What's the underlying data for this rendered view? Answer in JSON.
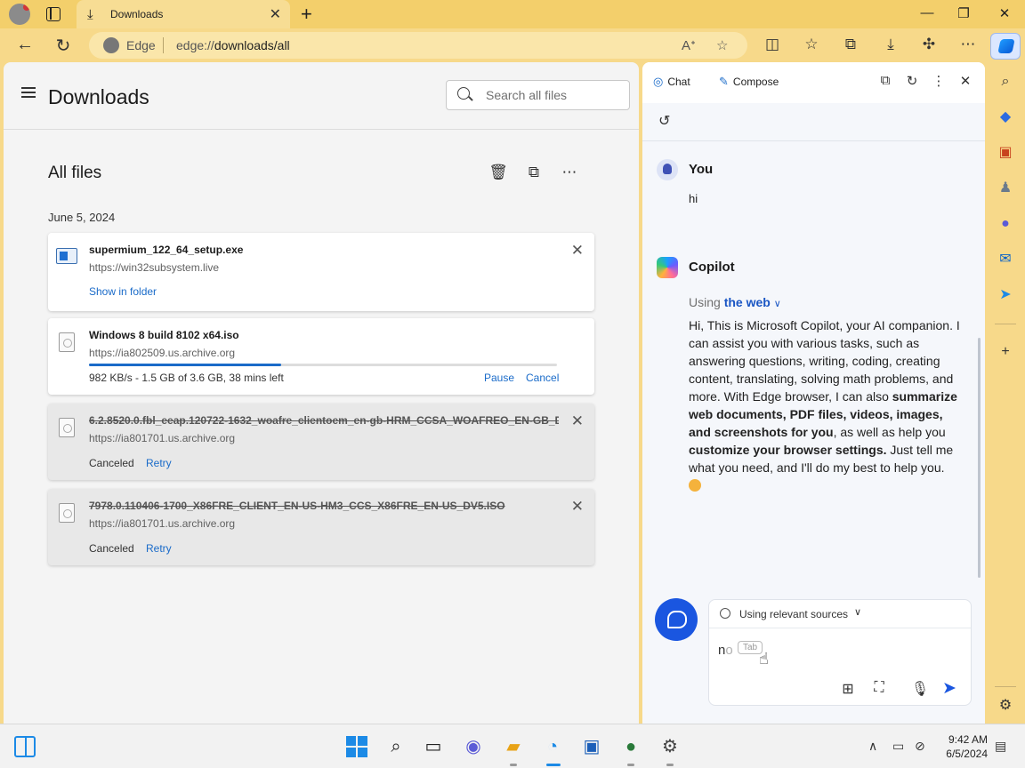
{
  "browser": {
    "tab_title": "Downloads",
    "site_label": "Edge",
    "url_prefix": "edge://",
    "url_path": "downloads/all"
  },
  "downloads_page": {
    "title": "Downloads",
    "search_placeholder": "Search all files",
    "section_title": "All files",
    "date_group": "June 5, 2024",
    "items": [
      {
        "name": "supermium_122_64_setup.exe",
        "source": "https://win32subsystem.live",
        "action": "Show in folder"
      },
      {
        "name": "Windows 8 build 8102 x64.iso",
        "source": "https://ia802509.us.archive.org",
        "progress_text": "982 KB/s - 1.5 GB of 3.6 GB, 38 mins left",
        "progress_fraction": 0.41,
        "pause_label": "Pause",
        "cancel_label": "Cancel"
      },
      {
        "name": "6.2.8520.0.fbl_eeap.120722-1632_woafre_clientoem_en-gb-HRM_CCSA_WOAFREO_EN-GB_D",
        "source": "https://ia801701.us.archive.org",
        "status": "Canceled",
        "retry_label": "Retry"
      },
      {
        "name": "7978.0.110406-1700_X86FRE_CLIENT_EN-US-HM3_CCS_X86FRE_EN-US_DV5.ISO",
        "source": "https://ia801701.us.archive.org",
        "status": "Canceled",
        "retry_label": "Retry"
      }
    ]
  },
  "copilot": {
    "tab_chat": "Chat",
    "tab_compose": "Compose",
    "user_name": "You",
    "user_message": "hi",
    "bot_name": "Copilot",
    "using_prefix": "Using",
    "using_source": "the web",
    "reply_part1": "Hi, This is Microsoft Copilot, your AI companion. I can assist you with various tasks, such as answering questions, writing, coding, creating content, translating, solving math problems, and more. With Edge browser, I can also ",
    "reply_bold1": "summarize web documents, PDF files, videos, images, and screenshots for you",
    "reply_part2": ", as well as help you ",
    "reply_bold2": "customize your browser settings.",
    "reply_part3": " Just tell me what you need, and I'll do my best to help you.",
    "sources_label": "Using relevant sources",
    "typed_text": "n",
    "typed_ghost": "o",
    "tab_hint": "Tab"
  },
  "taskbar": {
    "time": "9:42 AM",
    "date": "6/5/2024"
  },
  "colors": {
    "accent": "#1a6bc9",
    "frame": "#f7d98a",
    "copilot_blue": "#1a56e0"
  }
}
